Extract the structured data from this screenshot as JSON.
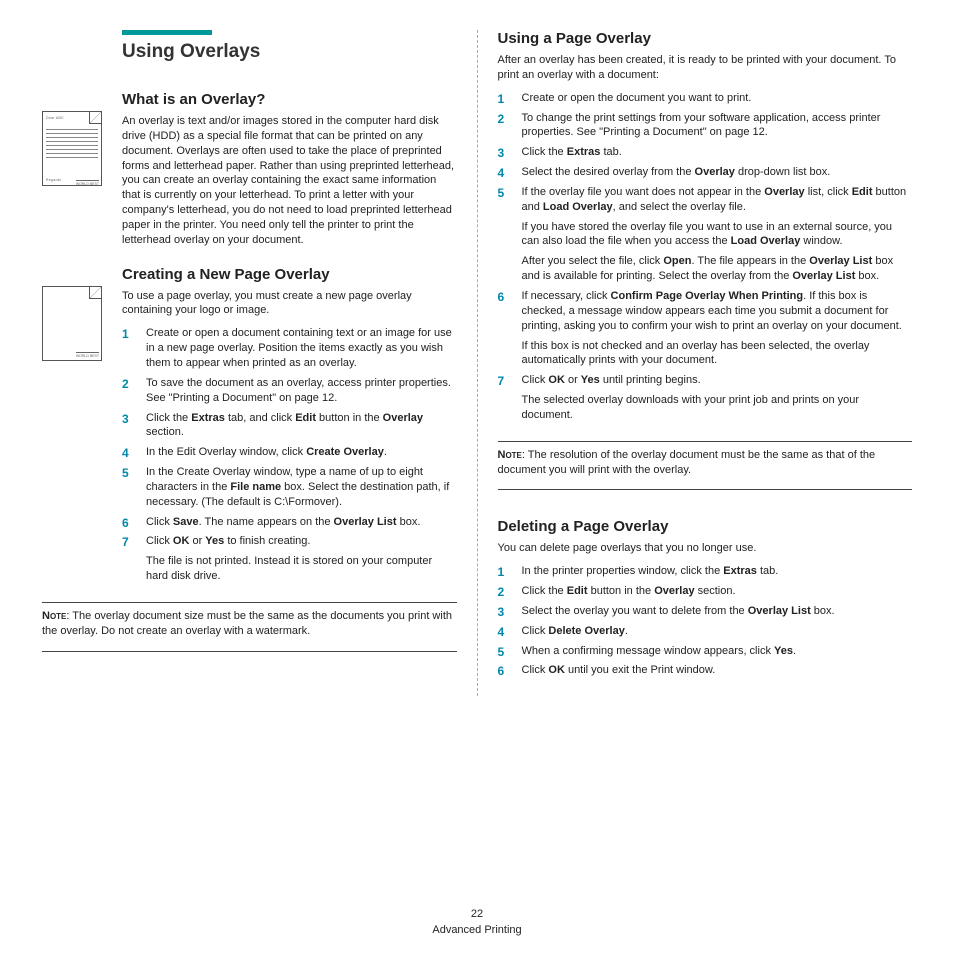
{
  "main_title": "Using Overlays",
  "page_number": "22",
  "footer_label": "Advanced Printing",
  "left": {
    "s1": {
      "heading": "What is an Overlay?",
      "body": "An overlay is text and/or images stored in the computer hard disk drive (HDD) as a special file format that can be printed on any document. Overlays are often used to take the place of preprinted forms and letterhead paper. Rather than using preprinted letterhead, you can create an overlay containing the exact same information that is currently on your letterhead. To print a letter with your company's letterhead, you do not need to load preprinted letterhead paper in the printer. You need only tell the printer to print the letterhead overlay on your document.",
      "icon_top": "Dear ABC",
      "icon_bot_l": "Regards",
      "icon_bot_r": "WORLD BEST"
    },
    "s2": {
      "heading": "Creating a New Page Overlay",
      "body": "To use a page overlay, you must create a new page overlay containing your logo or image.",
      "icon_bot_r": "WORLD BEST",
      "steps": {
        "1": "Create or open a document containing text or an image for use in a new page overlay. Position the items exactly as you wish them to appear when printed as an overlay.",
        "2": "To save the document as an overlay, access printer properties. See \"Printing a Document\" on page 12.",
        "3a": "Click the ",
        "3b": "Extras",
        "3c": " tab, and click ",
        "3d": "Edit",
        "3e": " button in the ",
        "3f": "Overlay",
        "3g": " section.",
        "4a": "In the Edit Overlay window, click ",
        "4b": "Create Overlay",
        "4c": ".",
        "5a": "In the Create Overlay window, type a name of up to eight characters in the ",
        "5b": "File name",
        "5c": " box. Select the destination path, if necessary. (The default is C:\\Formover).",
        "6a": "Click ",
        "6b": "Save",
        "6c": ". The name appears on the ",
        "6d": "Overlay List",
        "6e": " box.",
        "7a": "Click ",
        "7b": "OK",
        "7c": " or ",
        "7d": "Yes",
        "7e": " to finish creating.",
        "7sub": "The file is not printed. Instead it is stored on your computer hard disk drive."
      },
      "note_lead": "Note",
      "note": ": The overlay document size must be the same as the documents you print with the overlay. Do not create an overlay with a watermark."
    }
  },
  "right": {
    "s1": {
      "heading": "Using a Page Overlay",
      "body": "After an overlay has been created, it is ready to be printed with your document. To print an overlay with a document:",
      "steps": {
        "1": "Create or open the document you want to print.",
        "2": "To change the print settings from your software application, access printer properties. See \"Printing a Document\" on page 12.",
        "3a": "Click the ",
        "3b": "Extras",
        "3c": " tab.",
        "4a": "Select the desired overlay from the ",
        "4b": "Overlay",
        "4c": " drop-down list box.",
        "5a": "If the overlay file you want does not appear in the ",
        "5b": "Overlay",
        "5c": " list, click ",
        "5d": "Edit",
        "5e": " button and ",
        "5f": "Load Overlay",
        "5g": ", and select the overlay file.",
        "5sub1a": "If you have stored the overlay file you want to use in an external source, you can also load the file when you access the ",
        "5sub1b": "Load Overlay",
        "5sub1c": " window.",
        "5sub2a": "After you select the file, click ",
        "5sub2b": "Open",
        "5sub2c": ". The file appears in the ",
        "5sub2d": "Overlay List",
        "5sub2e": " box and is available for printing. Select the overlay from the ",
        "5sub2f": "Overlay List",
        "5sub2g": " box.",
        "6a": "If necessary, click ",
        "6b": "Confirm Page Overlay When Printing",
        "6c": ". If this box is checked, a message window appears each time you submit a document for printing, asking you to confirm your wish to print an overlay on your document.",
        "6sub": "If this box is not checked and an overlay has been selected, the overlay automatically prints with your document.",
        "7a": "Click ",
        "7b": "OK",
        "7c": " or ",
        "7d": "Yes",
        "7e": " until printing begins.",
        "7sub": "The selected overlay downloads with your print job and prints on your document."
      },
      "note_lead": "Note",
      "note": ": The resolution of the overlay document must be the same as that of the document you will print with the overlay."
    },
    "s2": {
      "heading": "Deleting a Page Overlay",
      "body": "You can delete page overlays that you no longer use.",
      "steps": {
        "1a": "In the printer properties window, click the ",
        "1b": "Extras",
        "1c": " tab.",
        "2a": "Click the ",
        "2b": "Edit",
        "2c": " button in the ",
        "2d": "Overlay",
        "2e": " section.",
        "3a": "Select the overlay you want to delete from the ",
        "3b": "Overlay List",
        "3c": " box.",
        "4a": "Click ",
        "4b": "Delete Overlay",
        "4c": ".",
        "5a": "When a confirming message window appears, click ",
        "5b": "Yes",
        "5c": ".",
        "6a": "Click ",
        "6b": "OK",
        "6c": " until you exit the Print window."
      }
    }
  }
}
